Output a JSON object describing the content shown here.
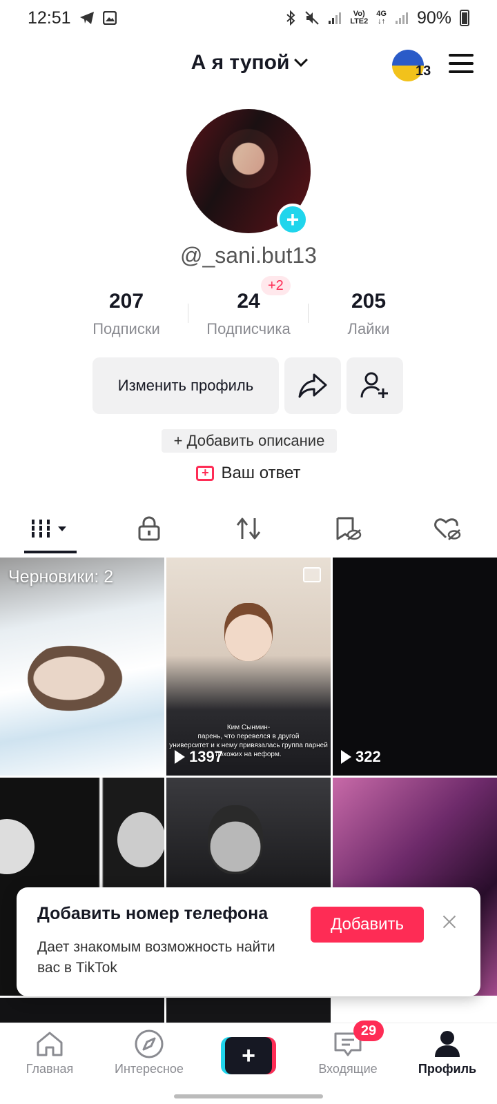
{
  "status_bar": {
    "time": "12:51",
    "net_top": "Vo)",
    "net_bottom": "LTE2",
    "gen_top": "4G",
    "gen_bottom": "↓↑",
    "battery": "90%"
  },
  "header": {
    "title": "А я тупой",
    "badge_count": "13"
  },
  "profile": {
    "handle": "@_sani.but13",
    "stats": [
      {
        "value": "207",
        "label": "Подписки"
      },
      {
        "value": "24",
        "label": "Подписчика"
      },
      {
        "value": "205",
        "label": "Лайки"
      }
    ],
    "followers_delta": "+2",
    "edit_label": "Изменить профиль",
    "add_description": "+ Добавить описание",
    "answer_label": "Ваш ответ"
  },
  "grid": {
    "drafts_label": "Черновики: 2",
    "caption": "Ким Сынмин-\nпарень, что перевелся в другой\nуниверситет и к нему привязалась группа парней\nпохожих на неформ.",
    "counts": [
      "1397",
      "322"
    ]
  },
  "phone_prompt": {
    "title": "Добавить номер телефона",
    "text": "Дает знакомым возможность найти вас в TikTok",
    "button": "Добавить"
  },
  "bottom_nav": {
    "items": [
      {
        "label": "Главная"
      },
      {
        "label": "Интересное"
      },
      {
        "label": "Входящие"
      },
      {
        "label": "Профиль"
      }
    ],
    "inbox_badge": "29"
  },
  "colors": {
    "accent": "#fe2c55",
    "cyan": "#20d5ec",
    "text": "#161823",
    "muted": "#8a8b91"
  }
}
